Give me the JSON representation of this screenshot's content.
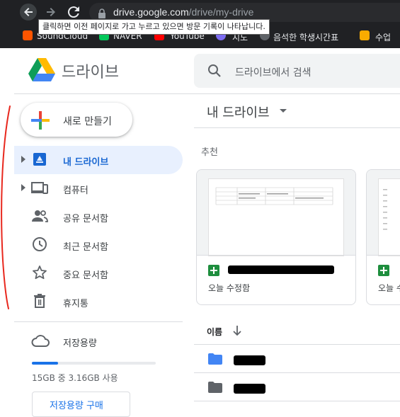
{
  "browser": {
    "url_host": "drive.google.com",
    "url_path": "/drive/my-drive",
    "back_tooltip": "클릭하면 이전 페이지로 가고 누르고 있으면 방문 기록이 나타납니다.",
    "bookmarks": [
      "SoundCloud",
      "NAVER",
      "YouTube",
      "지도",
      "음석한 학생시간표",
      "수업"
    ]
  },
  "app": {
    "title": "드라이브",
    "search_placeholder": "드라이브에서 검색"
  },
  "sidebar": {
    "new_label": "새로 만들기",
    "items": [
      {
        "label": "내 드라이브",
        "icon": "my-drive-icon",
        "active": true
      },
      {
        "label": "컴퓨터",
        "icon": "computer-icon"
      },
      {
        "label": "공유 문서함",
        "icon": "people-icon"
      },
      {
        "label": "최근 문서함",
        "icon": "clock-icon"
      },
      {
        "label": "중요 문서함",
        "icon": "star-icon"
      },
      {
        "label": "휴지통",
        "icon": "trash-icon"
      }
    ],
    "storage": {
      "label": "저장용량",
      "usage_text": "15GB 중 3.16GB 사용",
      "used_fraction": 0.21,
      "buy_label": "저장용량 구매"
    }
  },
  "main": {
    "title": "내 드라이브",
    "suggested_label": "추천",
    "cards": [
      {
        "subtitle": "오늘 수정함"
      },
      {
        "subtitle": "오늘 수"
      }
    ],
    "column_header": "이름"
  },
  "colors": {
    "accent": "#1a73e8",
    "active_bg": "#e8f0fe",
    "sheets_green": "#1e8e3e",
    "annotation_red": "#e8281e"
  }
}
